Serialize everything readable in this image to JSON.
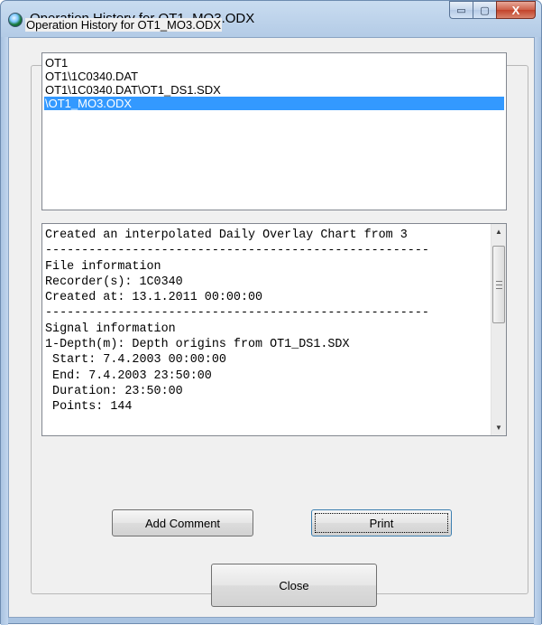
{
  "window": {
    "title": "Operation History for OT1_MO3.ODX",
    "caption_buttons": {
      "minimize_icon": "minimize-icon",
      "maximize_icon": "maximize-icon",
      "close_icon": "close-icon",
      "minimize_glyph": "▭",
      "maximize_glyph": "▢",
      "close_glyph": "X"
    }
  },
  "group": {
    "label": "Operation History for OT1_MO3.ODX"
  },
  "history_list": {
    "items": [
      "OT1",
      "OT1\\1C0340.DAT",
      "OT1\\1C0340.DAT\\OT1_DS1.SDX",
      "\\OT1_MO3.ODX"
    ],
    "selected_index": 3
  },
  "details": {
    "lines": [
      "Created an interpolated Daily Overlay Chart from 3",
      "-----------------------------------------------------",
      "File information",
      "Recorder(s): 1C0340",
      "Created at: 13.1.2011 00:00:00",
      "-----------------------------------------------------",
      "Signal information",
      "1-Depth(m): Depth origins from OT1_DS1.SDX",
      " Start: 7.4.2003 00:00:00",
      " End: 7.4.2003 23:50:00",
      " Duration: 23:50:00",
      " Points: 144"
    ],
    "scroll_up_glyph": "▲",
    "scroll_down_glyph": "▼"
  },
  "buttons": {
    "add_comment": "Add Comment",
    "print": "Print",
    "close": "Close"
  },
  "colors": {
    "selection": "#3399ff",
    "selection_text": "#ffffff",
    "client_bg": "#f0f0f0",
    "close_caption": "#c2432a"
  }
}
